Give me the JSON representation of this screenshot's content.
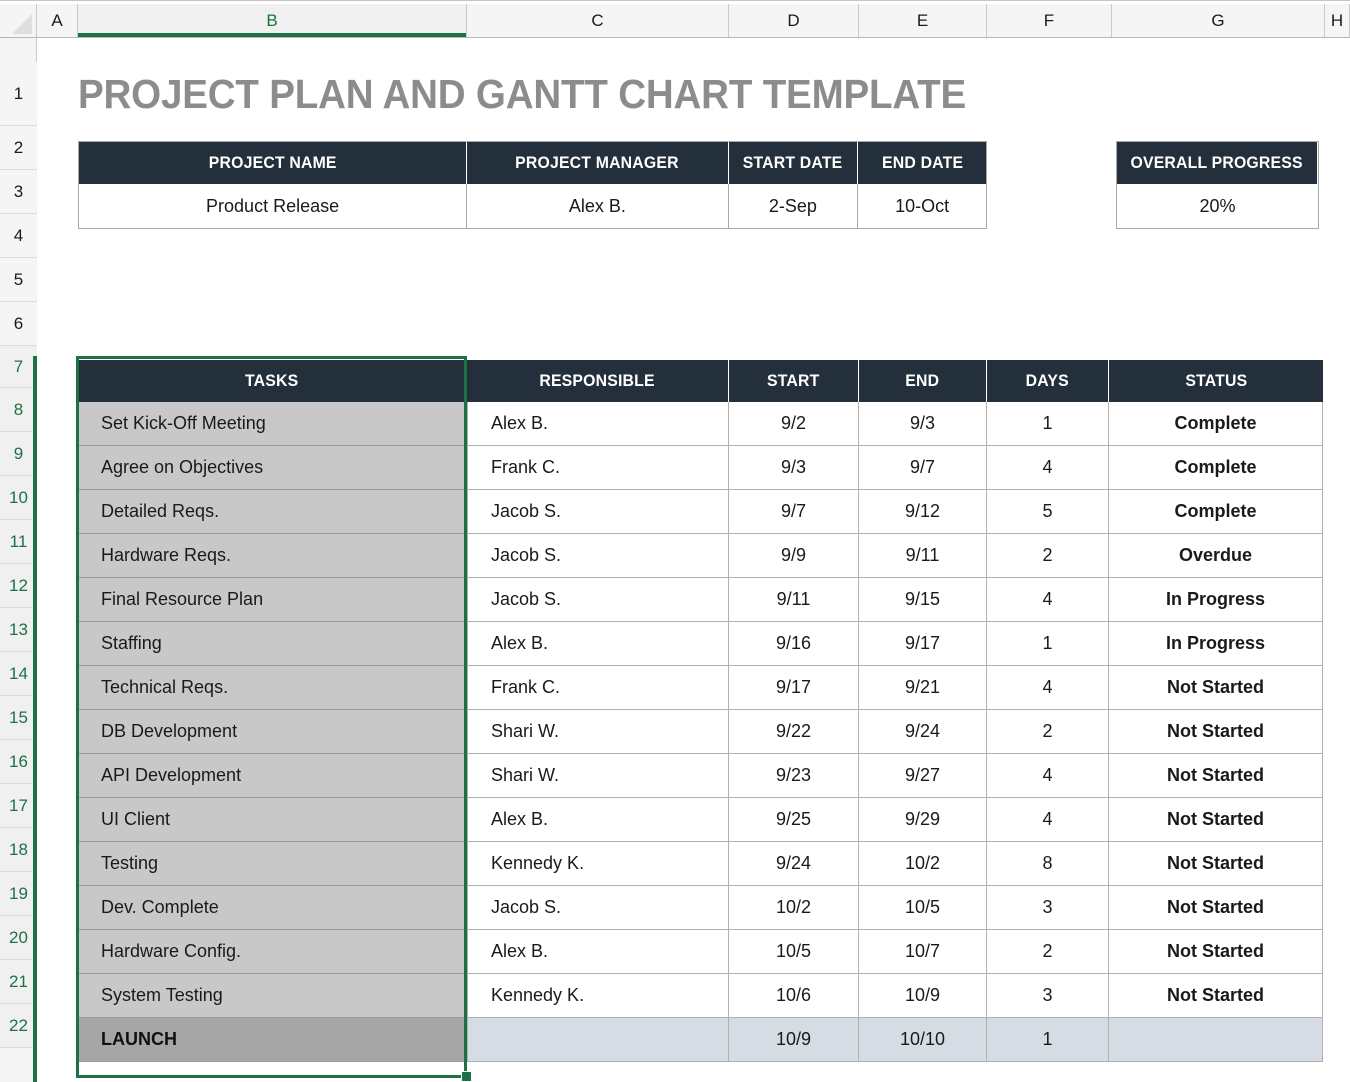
{
  "spreadsheet": {
    "column_headers": [
      "A",
      "B",
      "C",
      "D",
      "E",
      "F",
      "G",
      "H"
    ],
    "selected_column": "B",
    "row_headers": [
      "1",
      "2",
      "3",
      "4",
      "5",
      "6",
      "7",
      "8",
      "9",
      "10",
      "11",
      "12",
      "13",
      "14",
      "15",
      "16",
      "17",
      "18",
      "19",
      "20",
      "21",
      "22"
    ],
    "selected_rows": [
      "7",
      "8",
      "9",
      "10",
      "11",
      "12",
      "13",
      "14",
      "15",
      "16",
      "17",
      "18",
      "19",
      "20",
      "21",
      "22"
    ]
  },
  "title": "PROJECT PLAN AND GANTT CHART TEMPLATE",
  "summary": {
    "headers": [
      "PROJECT NAME",
      "PROJECT MANAGER",
      "START DATE",
      "END DATE"
    ],
    "values": [
      "Product Release",
      "Alex B.",
      "2-Sep",
      "10-Oct"
    ]
  },
  "overall_progress": {
    "label": "OVERALL PROGRESS",
    "value": "20%"
  },
  "tasks_table": {
    "headers": [
      "TASKS",
      "RESPONSIBLE",
      "START",
      "END",
      "DAYS",
      "STATUS"
    ],
    "rows": [
      {
        "task": "Set Kick-Off Meeting",
        "responsible": "Alex B.",
        "start": "9/2",
        "end": "9/3",
        "days": "1",
        "status": "Complete",
        "status_class": "st-complete"
      },
      {
        "task": "Agree on Objectives",
        "responsible": "Frank C.",
        "start": "9/3",
        "end": "9/7",
        "days": "4",
        "status": "Complete",
        "status_class": "st-complete"
      },
      {
        "task": "Detailed Reqs.",
        "responsible": "Jacob S.",
        "start": "9/7",
        "end": "9/12",
        "days": "5",
        "status": "Complete",
        "status_class": "st-complete"
      },
      {
        "task": "Hardware Reqs.",
        "responsible": "Jacob S.",
        "start": "9/9",
        "end": "9/11",
        "days": "2",
        "status": "Overdue",
        "status_class": "st-overdue"
      },
      {
        "task": "Final Resource Plan",
        "responsible": "Jacob S.",
        "start": "9/11",
        "end": "9/15",
        "days": "4",
        "status": "In Progress",
        "status_class": "st-inprogress"
      },
      {
        "task": "Staffing",
        "responsible": "Alex B.",
        "start": "9/16",
        "end": "9/17",
        "days": "1",
        "status": "In Progress",
        "status_class": "st-inprogress"
      },
      {
        "task": "Technical Reqs.",
        "responsible": "Frank C.",
        "start": "9/17",
        "end": "9/21",
        "days": "4",
        "status": "Not Started",
        "status_class": "st-notstarted"
      },
      {
        "task": "DB Development",
        "responsible": "Shari W.",
        "start": "9/22",
        "end": "9/24",
        "days": "2",
        "status": "Not Started",
        "status_class": "st-notstarted"
      },
      {
        "task": "API Development",
        "responsible": "Shari W.",
        "start": "9/23",
        "end": "9/27",
        "days": "4",
        "status": "Not Started",
        "status_class": "st-notstarted"
      },
      {
        "task": "UI Client",
        "responsible": "Alex B.",
        "start": "9/25",
        "end": "9/29",
        "days": "4",
        "status": "Not Started",
        "status_class": "st-notstarted"
      },
      {
        "task": "Testing",
        "responsible": "Kennedy K.",
        "start": "9/24",
        "end": "10/2",
        "days": "8",
        "status": "Not Started",
        "status_class": "st-notstarted"
      },
      {
        "task": "Dev. Complete",
        "responsible": "Jacob S.",
        "start": "10/2",
        "end": "10/5",
        "days": "3",
        "status": "Not Started",
        "status_class": "st-notstarted"
      },
      {
        "task": "Hardware Config.",
        "responsible": "Alex B.",
        "start": "10/5",
        "end": "10/7",
        "days": "2",
        "status": "Not Started",
        "status_class": "st-notstarted"
      },
      {
        "task": "System Testing",
        "responsible": "Kennedy K.",
        "start": "10/6",
        "end": "10/9",
        "days": "3",
        "status": "Not Started",
        "status_class": "st-notstarted"
      },
      {
        "task": "LAUNCH",
        "responsible": "",
        "start": "10/9",
        "end": "10/10",
        "days": "1",
        "status": "",
        "status_class": ""
      }
    ]
  },
  "colors": {
    "header_dark": "#232f3b",
    "title_gray": "#8c8c8c",
    "task_fill": "#c8c8c8",
    "launch_fill": "#a6a6a6",
    "launch_row_fill": "#d6dce4",
    "selection_green": "#1e7145",
    "status_complete": "#107a17",
    "status_overdue": "#f03c10",
    "status_in_progress": "#f03c10",
    "status_not_started": "#808080"
  }
}
